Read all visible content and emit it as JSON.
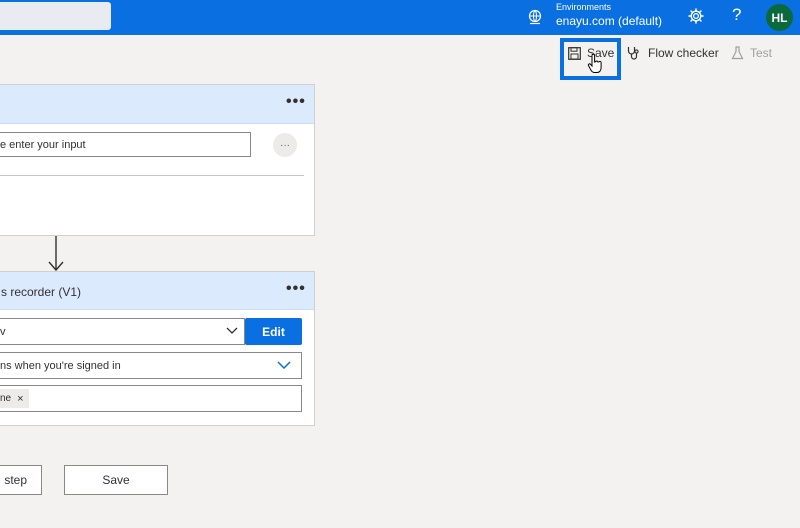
{
  "topbar": {
    "environment_label": "Environments",
    "environment_name": "enayu.com (default)",
    "help_glyph": "?",
    "avatar_initials": "HL",
    "brand_color": "#0a6fe0"
  },
  "commandbar": {
    "save_label": "Save",
    "flow_checker_label": "Flow checker",
    "test_label": "Test"
  },
  "card1": {
    "input_value": "e enter your input",
    "more_glyph": "•••",
    "ellipsis_glyph": "···"
  },
  "card2": {
    "title": "s recorder (V1)",
    "select1_value": "v",
    "edit_label": "Edit",
    "select2_value": "ns when you're signed in",
    "tag_text": "ne",
    "tag_remove_glyph": "×",
    "more_glyph": "•••"
  },
  "bottom": {
    "step_label": "step",
    "save_label": "Save"
  },
  "icons": {
    "environment": "globe-icon",
    "settings": "gear-icon",
    "help": "question-icon",
    "save": "floppy-disk-icon",
    "flow_checker": "stethoscope-icon",
    "test": "flask-icon",
    "cursor": "hand-pointer-icon"
  }
}
